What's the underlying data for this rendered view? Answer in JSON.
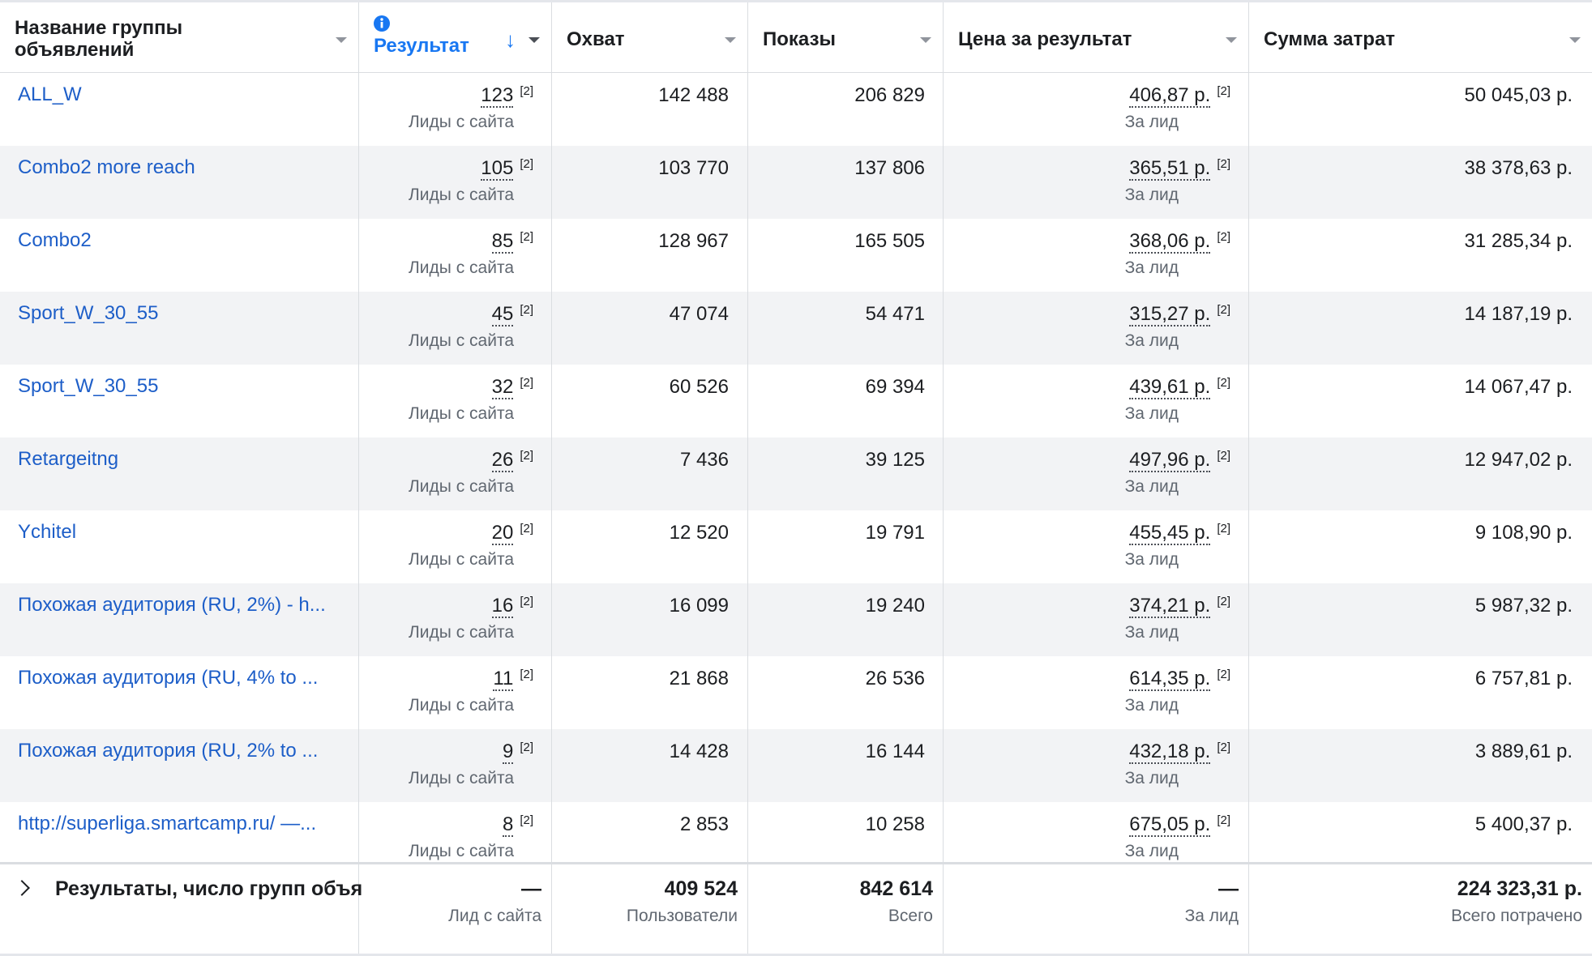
{
  "headers": {
    "name": "Название группы объявлений",
    "result": "Результат",
    "reach": "Охват",
    "impressions": "Показы",
    "cost_per_result": "Цена за результат",
    "amount_spent": "Сумма затрат"
  },
  "rows": [
    {
      "name": "ALL_W",
      "result": "123",
      "result_note": "[2]",
      "result_sub": "Лиды с сайта",
      "reach": "142 488",
      "impressions": "206 829",
      "cpr": "406,87 р.",
      "cpr_note": "[2]",
      "cpr_sub": "За лид",
      "spent": "50 045,03 р."
    },
    {
      "name": "Combo2 more reach",
      "result": "105",
      "result_note": "[2]",
      "result_sub": "Лиды с сайта",
      "reach": "103 770",
      "impressions": "137 806",
      "cpr": "365,51 р.",
      "cpr_note": "[2]",
      "cpr_sub": "За лид",
      "spent": "38 378,63 р."
    },
    {
      "name": "Combo2",
      "result": "85",
      "result_note": "[2]",
      "result_sub": "Лиды с сайта",
      "reach": "128 967",
      "impressions": "165 505",
      "cpr": "368,06 р.",
      "cpr_note": "[2]",
      "cpr_sub": "За лид",
      "spent": "31 285,34 р."
    },
    {
      "name": "Sport_W_30_55",
      "result": "45",
      "result_note": "[2]",
      "result_sub": "Лиды с сайта",
      "reach": "47 074",
      "impressions": "54 471",
      "cpr": "315,27 р.",
      "cpr_note": "[2]",
      "cpr_sub": "За лид",
      "spent": "14 187,19 р."
    },
    {
      "name": "Sport_W_30_55",
      "result": "32",
      "result_note": "[2]",
      "result_sub": "Лиды с сайта",
      "reach": "60 526",
      "impressions": "69 394",
      "cpr": "439,61 р.",
      "cpr_note": "[2]",
      "cpr_sub": "За лид",
      "spent": "14 067,47 р."
    },
    {
      "name": "Retargeitng",
      "result": "26",
      "result_note": "[2]",
      "result_sub": "Лиды с сайта",
      "reach": "7 436",
      "impressions": "39 125",
      "cpr": "497,96 р.",
      "cpr_note": "[2]",
      "cpr_sub": "За лид",
      "spent": "12 947,02 р."
    },
    {
      "name": "Ychitel",
      "result": "20",
      "result_note": "[2]",
      "result_sub": "Лиды с сайта",
      "reach": "12 520",
      "impressions": "19 791",
      "cpr": "455,45 р.",
      "cpr_note": "[2]",
      "cpr_sub": "За лид",
      "spent": "9 108,90 р."
    },
    {
      "name": "Похожая аудитория (RU, 2%) - h...",
      "result": "16",
      "result_note": "[2]",
      "result_sub": "Лиды с сайта",
      "reach": "16 099",
      "impressions": "19 240",
      "cpr": "374,21 р.",
      "cpr_note": "[2]",
      "cpr_sub": "За лид",
      "spent": "5 987,32 р."
    },
    {
      "name": "Похожая аудитория (RU, 4% to ...",
      "result": "11",
      "result_note": "[2]",
      "result_sub": "Лиды с сайта",
      "reach": "21 868",
      "impressions": "26 536",
      "cpr": "614,35 р.",
      "cpr_note": "[2]",
      "cpr_sub": "За лид",
      "spent": "6 757,81 р."
    },
    {
      "name": "Похожая аудитория (RU, 2% to ...",
      "result": "9",
      "result_note": "[2]",
      "result_sub": "Лиды с сайта",
      "reach": "14 428",
      "impressions": "16 144",
      "cpr": "432,18 р.",
      "cpr_note": "[2]",
      "cpr_sub": "За лид",
      "spent": "3 889,61 р."
    },
    {
      "name": "http://superliga.smartcamp.ru/ —...",
      "result": "8",
      "result_note": "[2]",
      "result_sub": "Лиды с сайта",
      "reach": "2 853",
      "impressions": "10 258",
      "cpr": "675,05 р.",
      "cpr_note": "[2]",
      "cpr_sub": "За лид",
      "spent": "5 400,37 р."
    }
  ],
  "footer": {
    "label": "Результаты, число групп объя",
    "result": "—",
    "result_sub": "Лид с сайта",
    "reach": "409 524",
    "reach_sub": "Пользователи",
    "impressions": "842 614",
    "impressions_sub": "Всего",
    "cpr": "—",
    "cpr_sub": "За лид",
    "spent": "224 323,31 р.",
    "spent_sub": "Всего потрачено"
  }
}
